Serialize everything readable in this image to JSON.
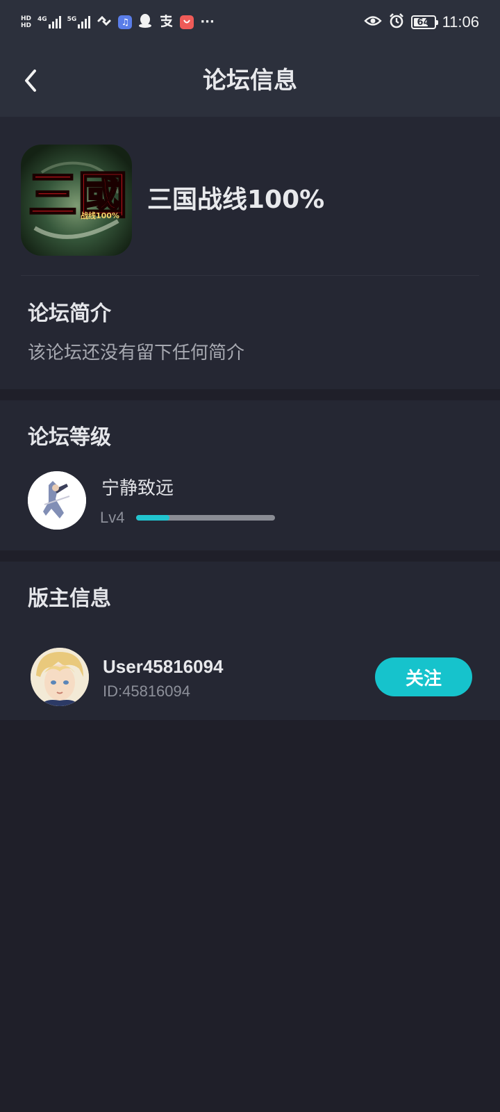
{
  "status_bar": {
    "hd_top": "HD",
    "hd_bottom": "HD",
    "net1": "4G",
    "net2": "5G",
    "battery": "64",
    "time": "11:06",
    "more": "···"
  },
  "header": {
    "title": "论坛信息",
    "back_icon": "chevron-left-icon"
  },
  "forum": {
    "name": "三国战线100%",
    "logo_text": "三國",
    "logo_sub": "战线100%"
  },
  "intro": {
    "title": "论坛简介",
    "text": "该论坛还没有留下任何简介"
  },
  "level": {
    "title": "论坛等级",
    "user_name": "宁静致远",
    "level_label": "Lv4",
    "progress": 0.24,
    "progress_color": "#21c4cf"
  },
  "moderator": {
    "title": "版主信息",
    "user_name": "User45816094",
    "user_id": "ID:45816094",
    "follow_label": "关注",
    "follow_color": "#16c3cc"
  }
}
